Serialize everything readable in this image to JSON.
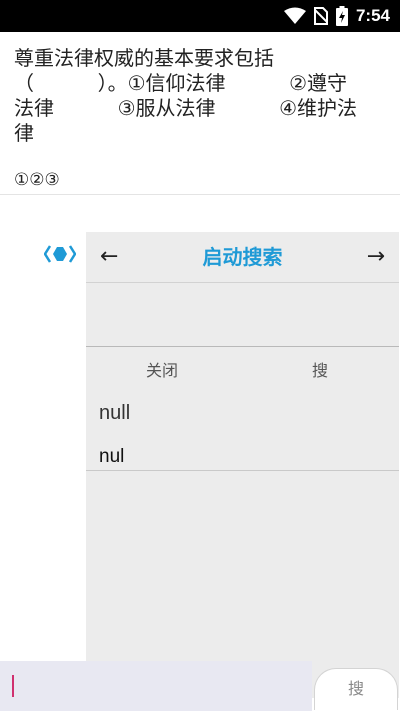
{
  "status_bar": {
    "time": "7:54",
    "icons": [
      "wifi-icon",
      "no-sim-icon",
      "battery-charging-icon"
    ]
  },
  "question": {
    "lines": [
      "尊重法律权威的基本要求包括",
      "（          ）。①信仰法律          ②遵守",
      "法律          ③服从法律          ④维护法",
      "律"
    ],
    "answer": "①②③"
  },
  "panel": {
    "back": "←",
    "forward": "→",
    "title": "启动搜索",
    "close_label": "关闭",
    "search_label": "搜",
    "results": [
      "null",
      "nul"
    ]
  },
  "bottom": {
    "input_value": "",
    "search_button": "搜"
  },
  "colors": {
    "accent": "#1f9ad6",
    "cursor": "#d0306f",
    "panel_bg": "#ececec",
    "input_bg": "#e8e8f2"
  }
}
